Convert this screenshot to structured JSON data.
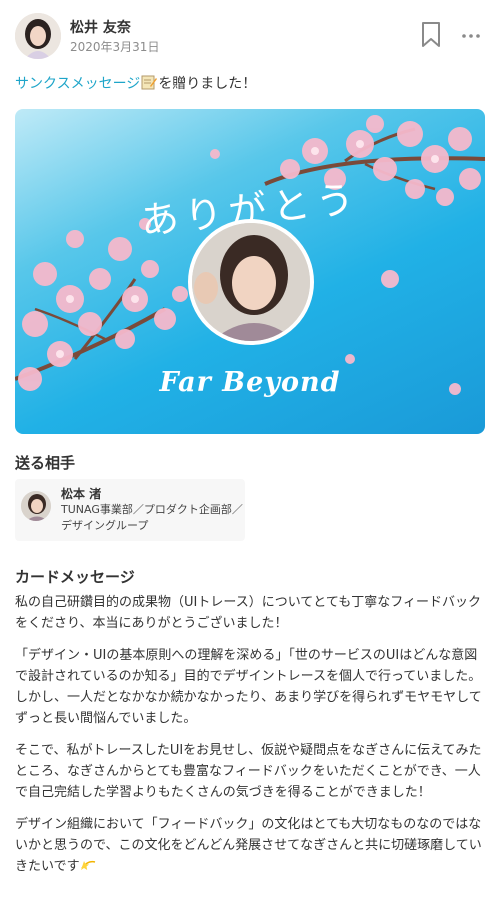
{
  "post": {
    "author_name": "松井 友奈",
    "date": "2020年3月31日",
    "sent_link": "サンクスメッセージ",
    "sent_suffix": "を贈りました！"
  },
  "card": {
    "title": "ありがとう",
    "signature": "Far Beyond",
    "colors": {
      "sky_top": "#bfeaf7",
      "sky_bottom": "#1a9ad8",
      "blossom": "#f6b9cc",
      "branch": "#7a4a3a"
    }
  },
  "recipient_section": {
    "label": "送る相手",
    "name": "松本 渚",
    "department": "TUNAG事業部／プロダクト企画部／デザイングループ"
  },
  "message_section": {
    "label": "カードメッセージ",
    "paragraphs": [
      "私の自己研鑽目的の成果物（UIトレース）についてとても丁寧なフィードバックをくださり、本当にありがとうございました！",
      "「デザイン・UIの基本原則への理解を深める」「世のサービスのUIはどんな意図で設計されているのか知る」目的でデザイントレースを個人で行っていました。しかし、一人だとなかなか続かなかったり、あまり学びを得られずモヤモヤしてずっと長い間悩んでいました。",
      "そこで、私がトレースしたUIをお見せし、仮説や疑問点をなぎさんに伝えてみたところ、なぎさんからとても豊富なフィードバックをいただくことができ、一人で自己完結した学習よりもたくさんの気づきを得ることができました！",
      "デザイン組織において「フィードバック」の文化はとても大切なものなのではないかと思うので、この文化をどんどん発展させてなぎさんと共に切磋琢磨していきたいです"
    ]
  },
  "icons": {
    "bookmark": "bookmark-icon",
    "more": "more-options-icon",
    "memo": "memo-emoji-icon",
    "sparkle": "dizzy-star-emoji-icon"
  },
  "colors": {
    "link": "#1ea5c9",
    "text": "#333333",
    "muted": "#8c8c8c"
  }
}
